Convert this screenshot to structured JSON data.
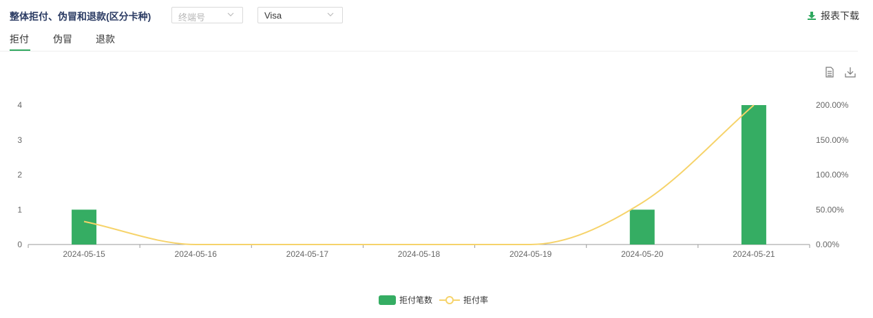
{
  "header": {
    "title": "整体拒付、伪冒和退款(区分卡种)",
    "terminal_select": {
      "placeholder": "终端号"
    },
    "card_select": {
      "value": "Visa"
    },
    "download_label": "报表下载"
  },
  "tabs": [
    {
      "label": "拒付",
      "active": true
    },
    {
      "label": "伪冒",
      "active": false
    },
    {
      "label": "退款",
      "active": false
    }
  ],
  "toolbar": {
    "icons": [
      "document-icon",
      "download-icon"
    ]
  },
  "colors": {
    "bar": "#35ad63",
    "line": "#f6d36a",
    "accent": "#2fa85f",
    "title": "#2b3b63"
  },
  "chart_data": {
    "type": "bar",
    "categories": [
      "2024-05-15",
      "2024-05-16",
      "2024-05-17",
      "2024-05-18",
      "2024-05-19",
      "2024-05-20",
      "2024-05-21"
    ],
    "series": [
      {
        "name": "拒付笔数",
        "type": "bar",
        "axis": "left",
        "values": [
          1,
          0,
          0,
          0,
          0,
          1,
          4
        ]
      },
      {
        "name": "拒付率",
        "type": "line",
        "axis": "right",
        "smooth": true,
        "values": [
          33,
          0,
          0,
          0,
          0,
          60,
          200
        ]
      }
    ],
    "y_left": {
      "ticks": [
        "0",
        "1",
        "2",
        "3",
        "4"
      ],
      "range": [
        0,
        4
      ]
    },
    "y_right": {
      "ticks": [
        "0.00%",
        "50.00%",
        "100.00%",
        "150.00%",
        "200.00%"
      ],
      "range": [
        0,
        200
      ]
    },
    "legend_position": "bottom-center",
    "grid": false
  }
}
